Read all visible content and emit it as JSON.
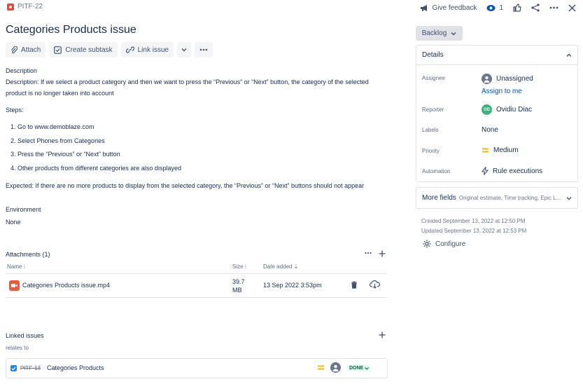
{
  "header": {
    "issue_key": "PITF-22",
    "give_feedback": "Give feedback",
    "watch_count": "1"
  },
  "issue": {
    "title": "Categories Products issue"
  },
  "toolbar": {
    "attach": "Attach",
    "create_subtask": "Create subtask",
    "link_issue": "Link issue"
  },
  "description": {
    "label": "Description",
    "line1": "Description: If we select a product category and then we want to press the “Previous” or “Next” button, the category of the selected",
    "line2": "product is no longer taken into account",
    "steps_label": "Steps:",
    "steps": [
      "1. Go to www.demoblaze.com",
      "2. Select Phones from Categories",
      "3.  Press the “Previous” or “Next” button",
      "4. Other products from different categories are also displayed"
    ],
    "expected": "Expected: If there are no more products to display from the selected category, the “Previous” or “Next” buttons should not appear"
  },
  "environment": {
    "label": "Environment",
    "value": "None"
  },
  "attachments": {
    "label": "Attachments (1)",
    "col_name": "Name",
    "col_size": "Size",
    "col_date": "Date added",
    "rows": [
      {
        "name": "Categories Products issue.mp4",
        "size_1": "39.7",
        "size_2": "MB",
        "date": "13 Sep 2022 3:53pm"
      }
    ]
  },
  "linked": {
    "label": "Linked issues",
    "relation": "relates to",
    "items": [
      {
        "key": "PITF-13",
        "summary": "Categories Products",
        "status": "DONE"
      }
    ]
  },
  "sidebar": {
    "status": "Backlog",
    "details_label": "Details",
    "assignee_label": "Assignee",
    "assignee_value": "Unassigned",
    "assign_to_me": "Assign to me",
    "reporter_label": "Reporter",
    "reporter_initials": "OD",
    "reporter_value": "Ovidiu Diac",
    "labels_label": "Labels",
    "labels_value": "None",
    "priority_label": "Priority",
    "priority_value": "Medium",
    "automation_label": "Automation",
    "automation_value": "Rule executions",
    "more_fields": "More fields",
    "more_fields_hint": "Original estimate, Time tracking, Epic L...",
    "created": "Created September 13, 2022 at 12:50 PM",
    "updated": "Updated September 13, 2022 at 12:53 PM",
    "configure": "Configure"
  },
  "colors": {
    "bug": "#e5493a",
    "link": "#0052cc",
    "priority_medium": "#ffab00",
    "done_bg": "#e3fcef",
    "done_text": "#006644",
    "reporter_avatar": "#36b37e"
  }
}
